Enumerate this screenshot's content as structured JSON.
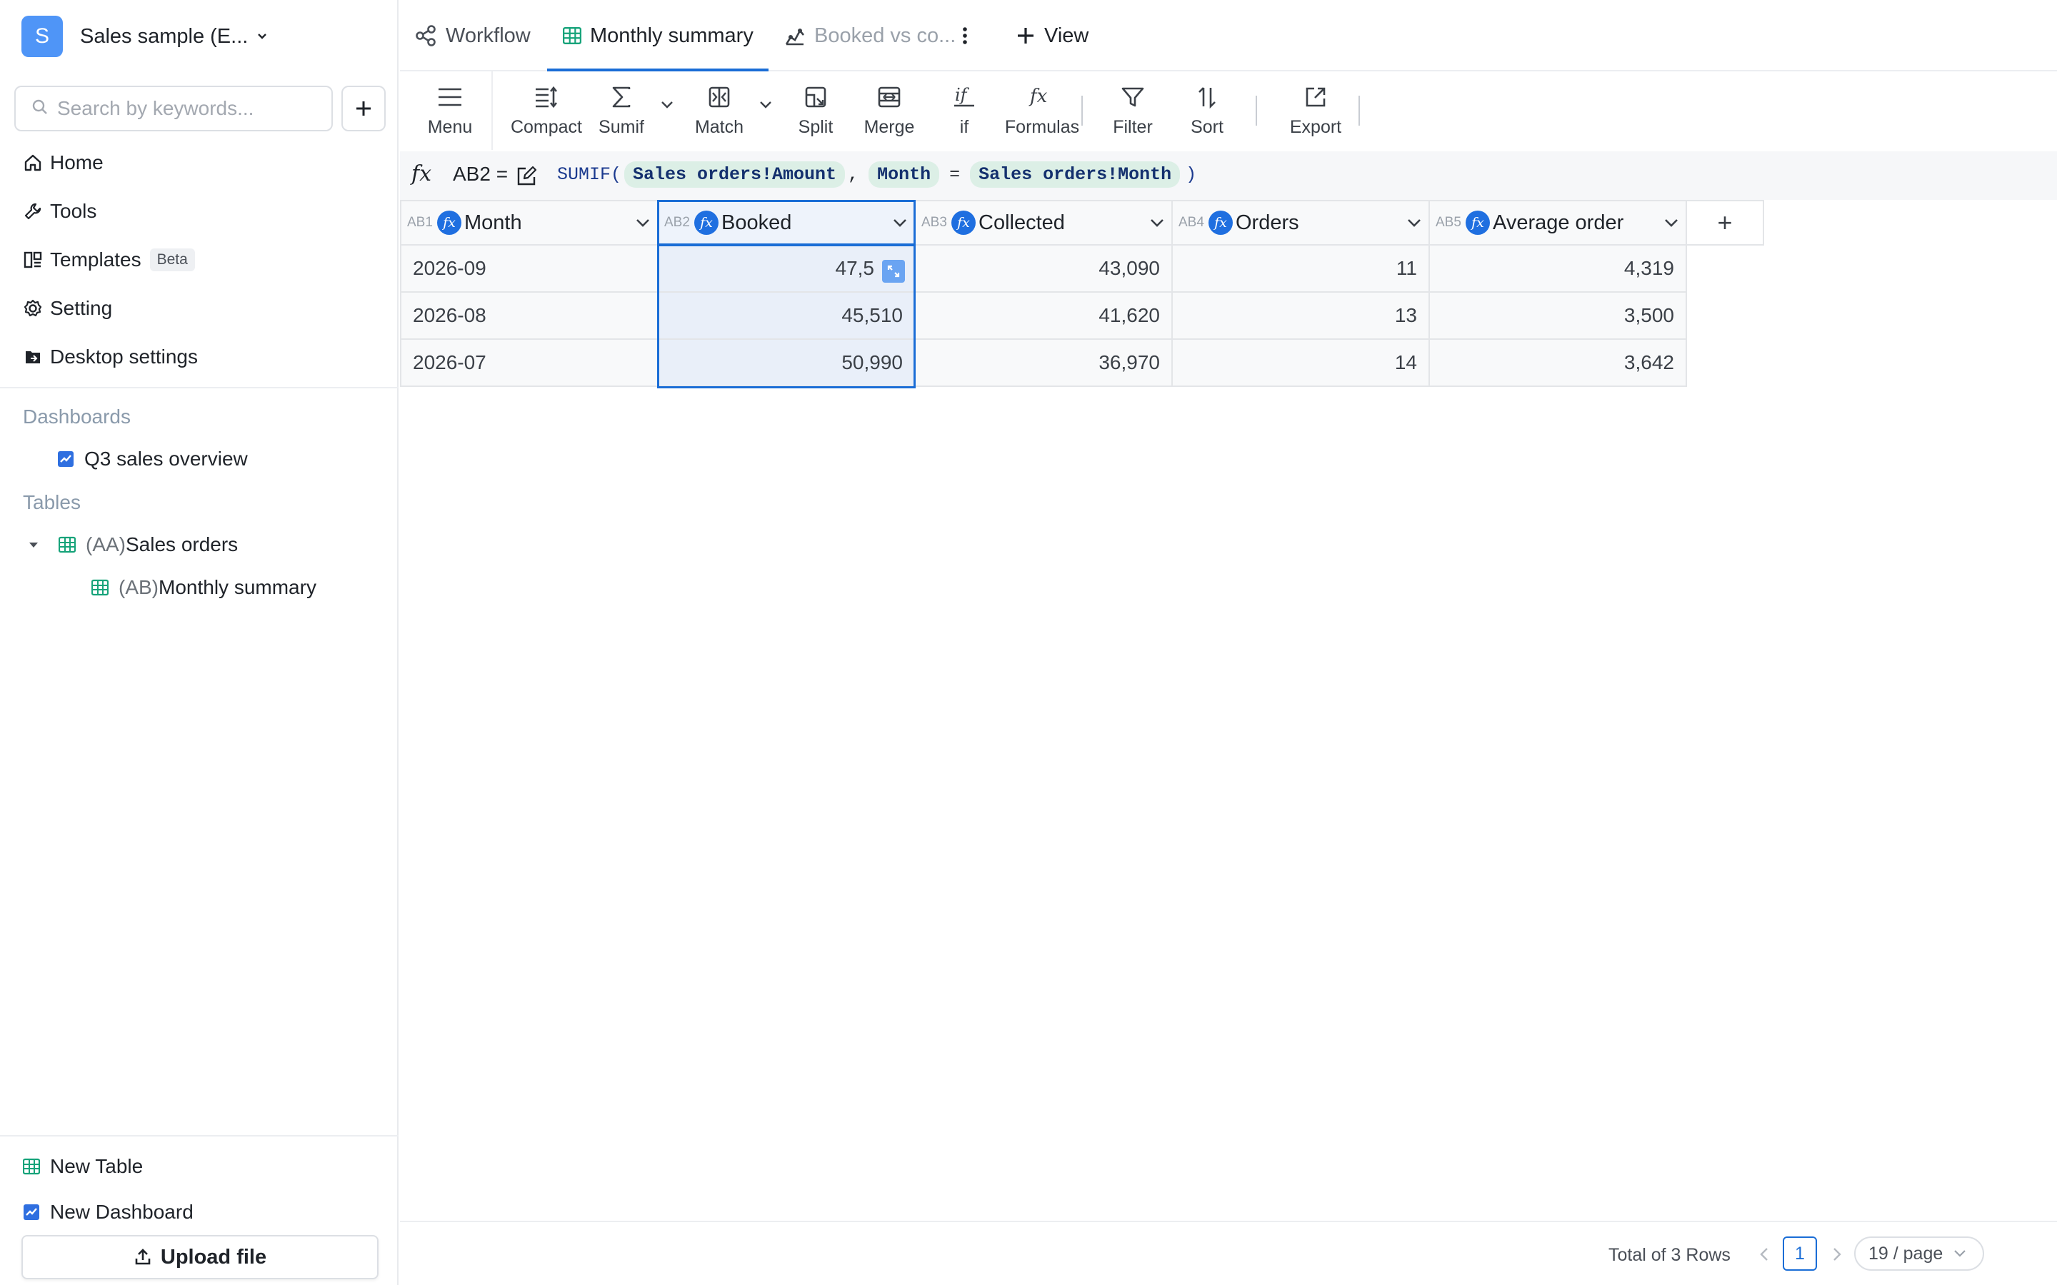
{
  "workspace": {
    "avatar_letter": "S",
    "name": "Sales sample (E...",
    "accent": "#4f95f7"
  },
  "search": {
    "placeholder": "Search by keywords..."
  },
  "nav": {
    "home": "Home",
    "tools": "Tools",
    "templates": "Templates",
    "templates_badge": "Beta",
    "setting": "Setting",
    "desktop_settings": "Desktop settings"
  },
  "sections": {
    "dashboards_title": "Dashboards",
    "dashboards": [
      "Q3 sales overview"
    ],
    "tables_title": "Tables",
    "tables": [
      {
        "prefix": "(AA)",
        "name": "Sales orders"
      },
      {
        "prefix": "(AB)",
        "name": "Monthly summary"
      }
    ]
  },
  "bottom": {
    "new_table": "New Table",
    "new_dashboard": "New Dashboard",
    "upload": "Upload file"
  },
  "tabs": {
    "workflow": "Workflow",
    "monthly_summary": "Monthly summary",
    "booked_vs": "Booked vs co...",
    "view": "View"
  },
  "toolbar": {
    "menu": "Menu",
    "compact": "Compact",
    "sumif": "Sumif",
    "match": "Match",
    "split": "Split",
    "merge": "Merge",
    "if": "if",
    "formulas": "Formulas",
    "filter": "Filter",
    "sort": "Sort",
    "export": "Export"
  },
  "formula_bar": {
    "cell_ref": "AB2 =",
    "fn_open": "SUMIF(",
    "arg1": "Sales orders!Amount",
    "comma": ",",
    "arg2": "Month",
    "op": "=",
    "arg3": "Sales orders!Month",
    "fn_close": ")"
  },
  "grid": {
    "columns": [
      {
        "ref": "AB1",
        "name": "Month"
      },
      {
        "ref": "AB2",
        "name": "Booked"
      },
      {
        "ref": "AB3",
        "name": "Collected"
      },
      {
        "ref": "AB4",
        "name": "Orders"
      },
      {
        "ref": "AB5",
        "name": "Average order"
      }
    ],
    "rows": [
      [
        "2026-09",
        "47,5",
        "43,090",
        "11",
        "4,319"
      ],
      [
        "2026-08",
        "45,510",
        "41,620",
        "13",
        "3,500"
      ],
      [
        "2026-07",
        "50,990",
        "36,970",
        "14",
        "3,642"
      ]
    ],
    "add_column": "+"
  },
  "footer": {
    "total": "Total of 3 Rows",
    "page": "1",
    "page_size": "19 / page"
  }
}
